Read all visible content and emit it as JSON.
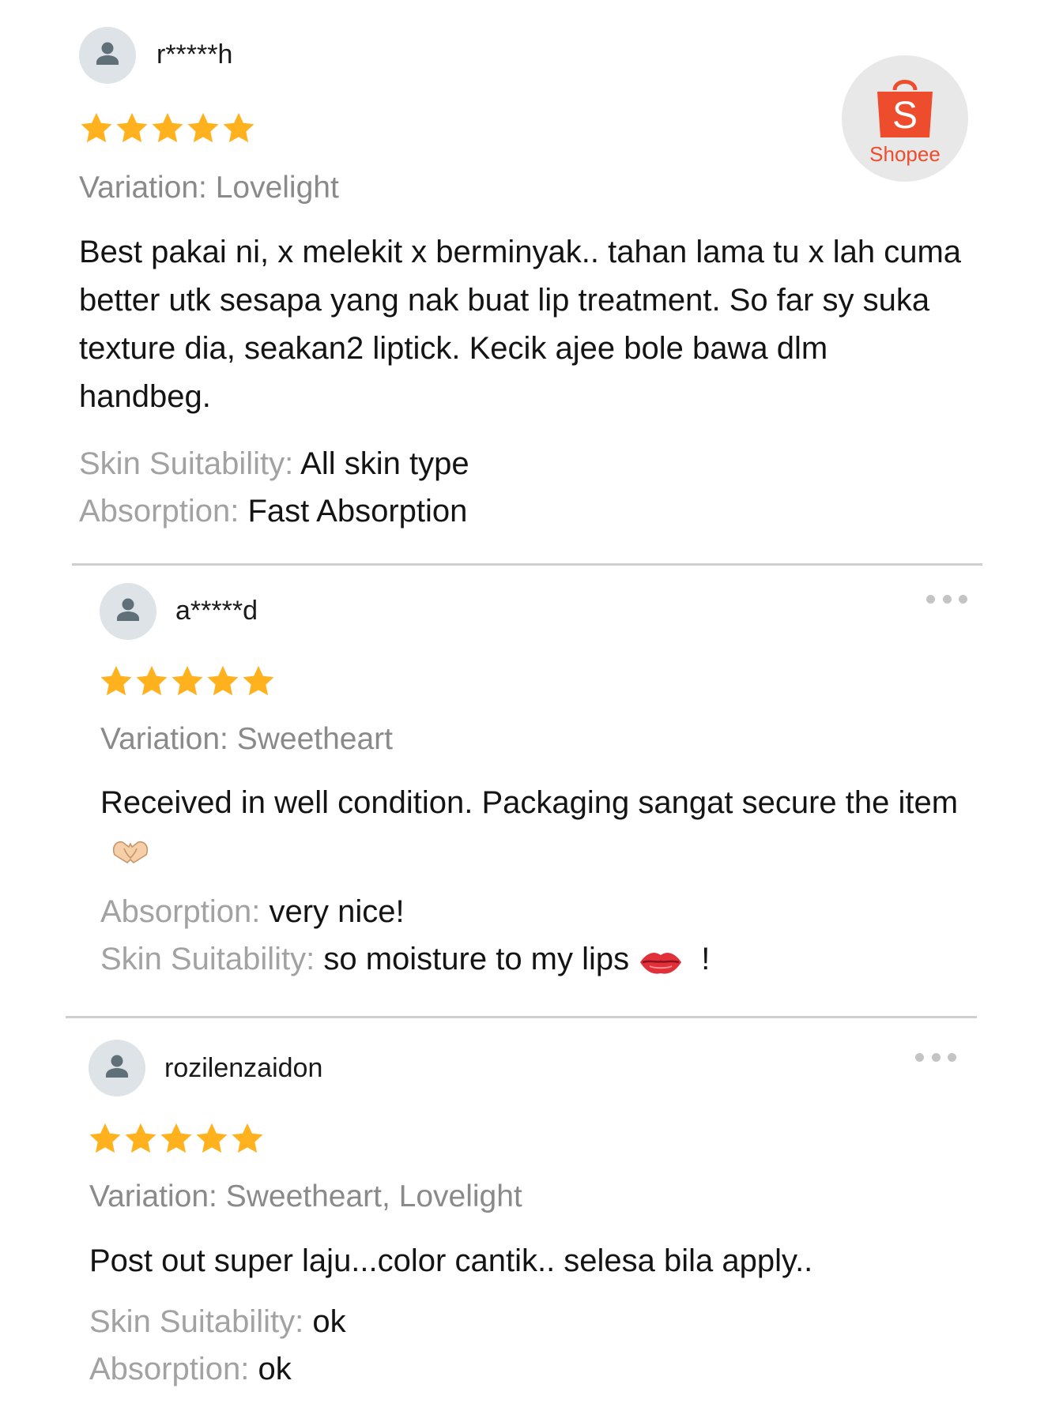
{
  "brand": {
    "name": "Shopee",
    "logo_letter": "S",
    "color": "#ee4d2d"
  },
  "reviews": [
    {
      "username": "r*****h",
      "rating": 5,
      "variation": "Variation: Lovelight",
      "comment": "Best pakai ni, x melekit x berminyak.. tahan lama tu x lah cuma better utk sesapa yang nak buat lip treatment. So far sy suka texture dia, seakan2 liptick. Kecik ajee bole bawa dlm handbeg.",
      "attributes": [
        {
          "label": "Skin Suitability:",
          "value": "All skin type"
        },
        {
          "label": "Absorption:",
          "value": "Fast Absorption"
        }
      ]
    },
    {
      "username": "a*****d",
      "rating": 5,
      "variation": "Variation: Sweetheart",
      "comment": "Received in well condition. Packaging sangat secure the item",
      "comment_emoji": "heart-hands-emoji",
      "attributes": [
        {
          "label": "Absorption:",
          "value": "very nice!"
        },
        {
          "label": "Skin Suitability:",
          "value": "so moisture to my lips",
          "emoji": "lips-emoji",
          "suffix": "!"
        }
      ]
    },
    {
      "username": "rozilenzaidon",
      "rating": 5,
      "variation": "Variation: Sweetheart, Lovelight",
      "comment": "Post out super laju...color cantik.. selesa bila apply..",
      "attributes": [
        {
          "label": "Skin Suitability:",
          "value": "ok"
        },
        {
          "label": "Absorption:",
          "value": "ok"
        }
      ]
    }
  ],
  "icons": {
    "avatar": "user-avatar-icon",
    "star": "star-icon",
    "more": "more-options-icon"
  },
  "colors": {
    "star": "#ffb21e",
    "avatar_bg": "#dde3e6",
    "avatar_fg": "#5f7079",
    "label_grey": "#a2a2a2",
    "variation_grey": "#8a8a8a",
    "divider": "#cfcfcf"
  }
}
